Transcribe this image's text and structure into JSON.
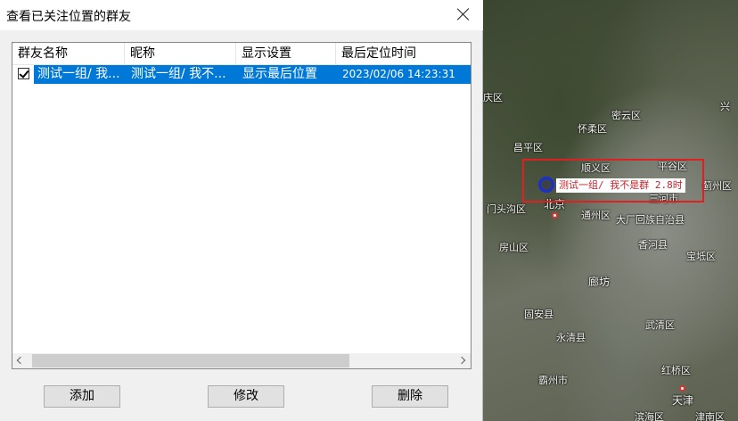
{
  "dialog": {
    "title": "查看已关注位置的群友",
    "columns": [
      "群友名称",
      "昵称",
      "显示设置",
      "最后定位时间"
    ],
    "rows": [
      {
        "checked": true,
        "name": "测试一组/ 我...",
        "nickname": "测试一组/ 我不...",
        "display": "显示最后位置",
        "last_time": "2023/02/06 14:23:31"
      }
    ],
    "buttons": {
      "add": "添加",
      "edit": "修改",
      "delete": "删除"
    }
  },
  "map": {
    "labels": [
      "庆区",
      "兴",
      "密云区",
      "怀柔区",
      "昌平区",
      "顺义区",
      "平谷区",
      "蓟州区",
      "门头沟区",
      "北京",
      "通州区",
      "大厂回族自治县",
      "三河市",
      "房山区",
      "香河县",
      "宝坻区",
      "廊坊",
      "固安县",
      "武清区",
      "永清县",
      "霸州市",
      "红桥区",
      "天津",
      "滨海区",
      "津南区"
    ],
    "marker_label": "测试一组/ 我不是群 2.8时",
    "colors": {
      "highlight": "#e02020",
      "marker": "#1a2fd0",
      "marker_text": "#c0262d"
    }
  }
}
